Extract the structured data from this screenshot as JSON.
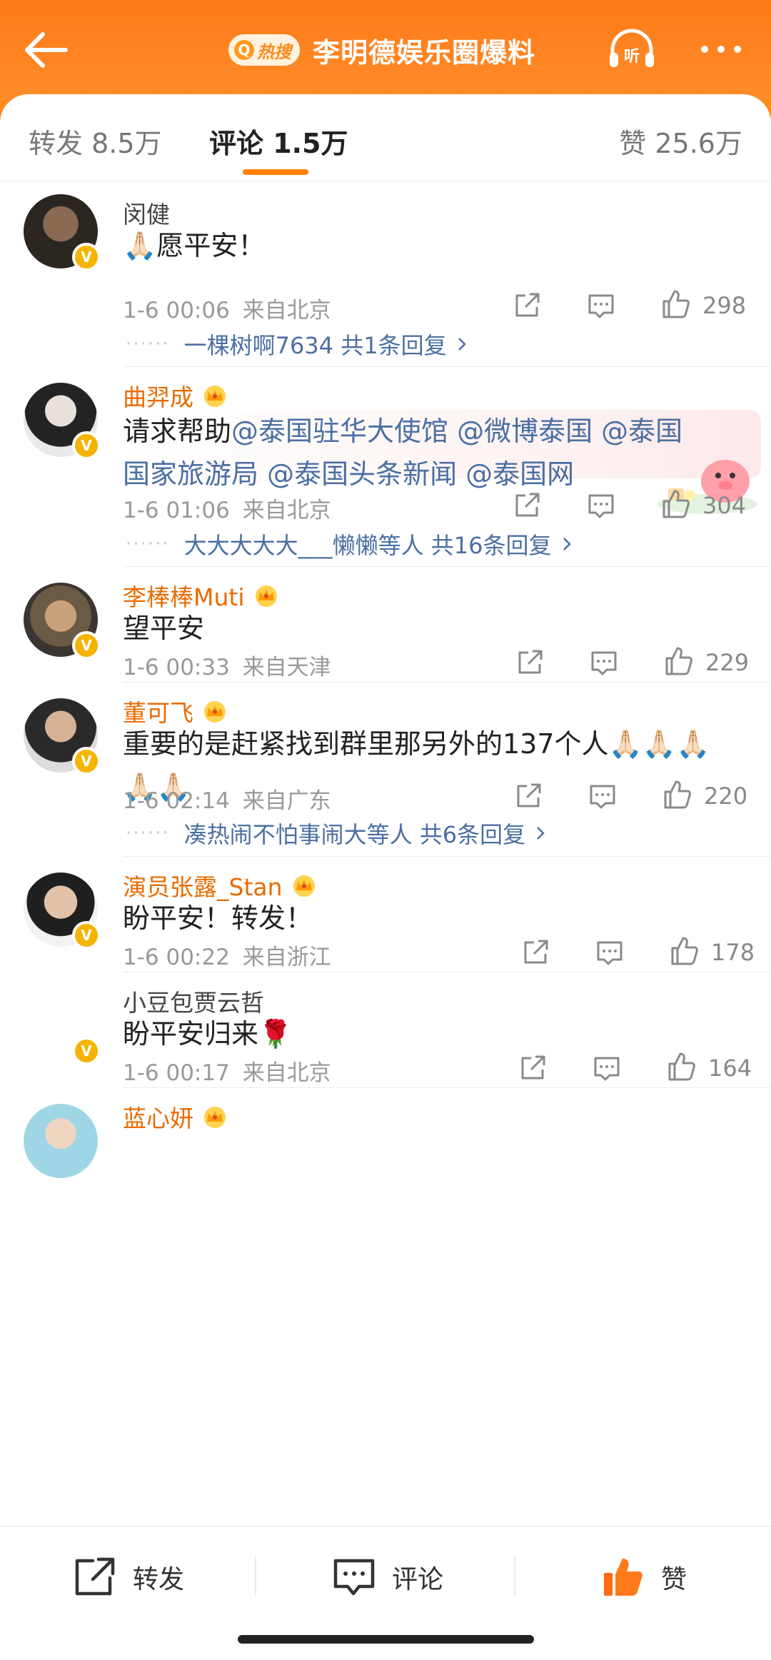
{
  "header": {
    "hot_badge": "热搜",
    "title": "李明德娱乐圈爆料",
    "listen_label": "听"
  },
  "tabs": {
    "repost": "转发 8.5万",
    "comment": "评论 1.5万",
    "like": "赞 25.6万"
  },
  "comments": [
    {
      "user": "闵健",
      "text": "🙏🏻愿平安！",
      "time": "1-6 00:06",
      "location": "来自北京",
      "likes": "298",
      "replies": "一棵树啊7634  共1条回复"
    },
    {
      "user": "曲羿成",
      "text_prefix": "请求帮助",
      "mentions_line1": "@泰国驻华大使馆 @微博泰国 @泰国",
      "mentions_line2": "国家旅游局 @泰国头条新闻 @泰国网",
      "time": "1-6 01:06",
      "location": "来自北京",
      "likes": "304",
      "replies_name": "大大大大大___懒懒",
      "replies_rest": "等人  共16条回复"
    },
    {
      "user": "李棒棒Muti",
      "text": "望平安",
      "time": "1-6 00:33",
      "location": "来自天津",
      "likes": "229"
    },
    {
      "user": "董可飞",
      "text_line1": "重要的是赶紧找到群里那另外的137个人🙏🏻🙏🏻🙏🏻",
      "text_line2": "🙏🏻🙏🏻",
      "time": "1-6 02:14",
      "location": "来自广东",
      "likes": "220",
      "replies": "凑热闹不怕事闹大等人  共6条回复"
    },
    {
      "user": "演员张露_Stan",
      "text": "盼平安！转发！",
      "time": "1-6 00:22",
      "location": "来自浙江",
      "likes": "178"
    },
    {
      "user": "小豆包贾云哲",
      "text": "盼平安归来🌹",
      "time": "1-6 00:17",
      "location": "来自北京",
      "likes": "164"
    },
    {
      "user": "蓝心妍"
    }
  ],
  "bottom_bar": {
    "repost": "转发",
    "comment": "评论",
    "like": "赞"
  },
  "colors": {
    "header": "#ff7a18",
    "accent": "#ff8200",
    "mention": "#4b6fa3",
    "vip_name": "#e86b00"
  }
}
